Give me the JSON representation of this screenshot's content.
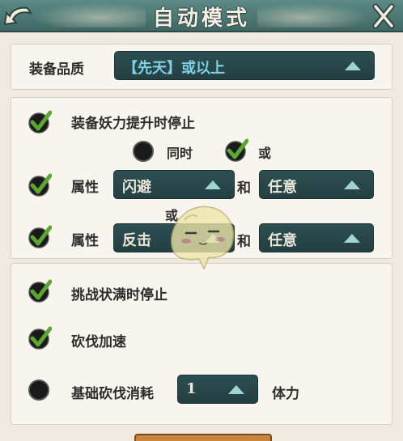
{
  "header": {
    "title": "自动模式"
  },
  "quality": {
    "label": "装备品质",
    "value": "【先天】或以上"
  },
  "demon_stop": {
    "label": "装备妖力提升时停止"
  },
  "logic": {
    "same_time": "同时",
    "or": "或"
  },
  "attr_row1": {
    "label": "属性",
    "left_value": "闪避",
    "joiner": "和",
    "right_value": "任意"
  },
  "or_between": "或",
  "attr_row2": {
    "label": "属性",
    "left_value": "反击",
    "joiner": "和",
    "right_value": "任意"
  },
  "challenge_stop": {
    "label": "挑战状满时停止"
  },
  "chop_speed": {
    "label": "砍伐加速"
  },
  "chop_cost": {
    "label": "基础砍伐消耗",
    "value": "1",
    "unit": "体力"
  },
  "colors": {
    "header_teal": "#4f7975",
    "dropdown_bg": "#2d4f52",
    "dropdown_arrow": "#9fd4cf",
    "check_green": "#4e9a2c",
    "panel_bg": "#f8f5ee",
    "page_bg": "#efe9df"
  },
  "states": {
    "demon_stop_checked": true,
    "same_time_selected": false,
    "or_selected": true,
    "attr_row1_checked": true,
    "attr_row2_checked": true,
    "challenge_stop_checked": true,
    "chop_speed_checked": true,
    "chop_cost_checked": false
  }
}
